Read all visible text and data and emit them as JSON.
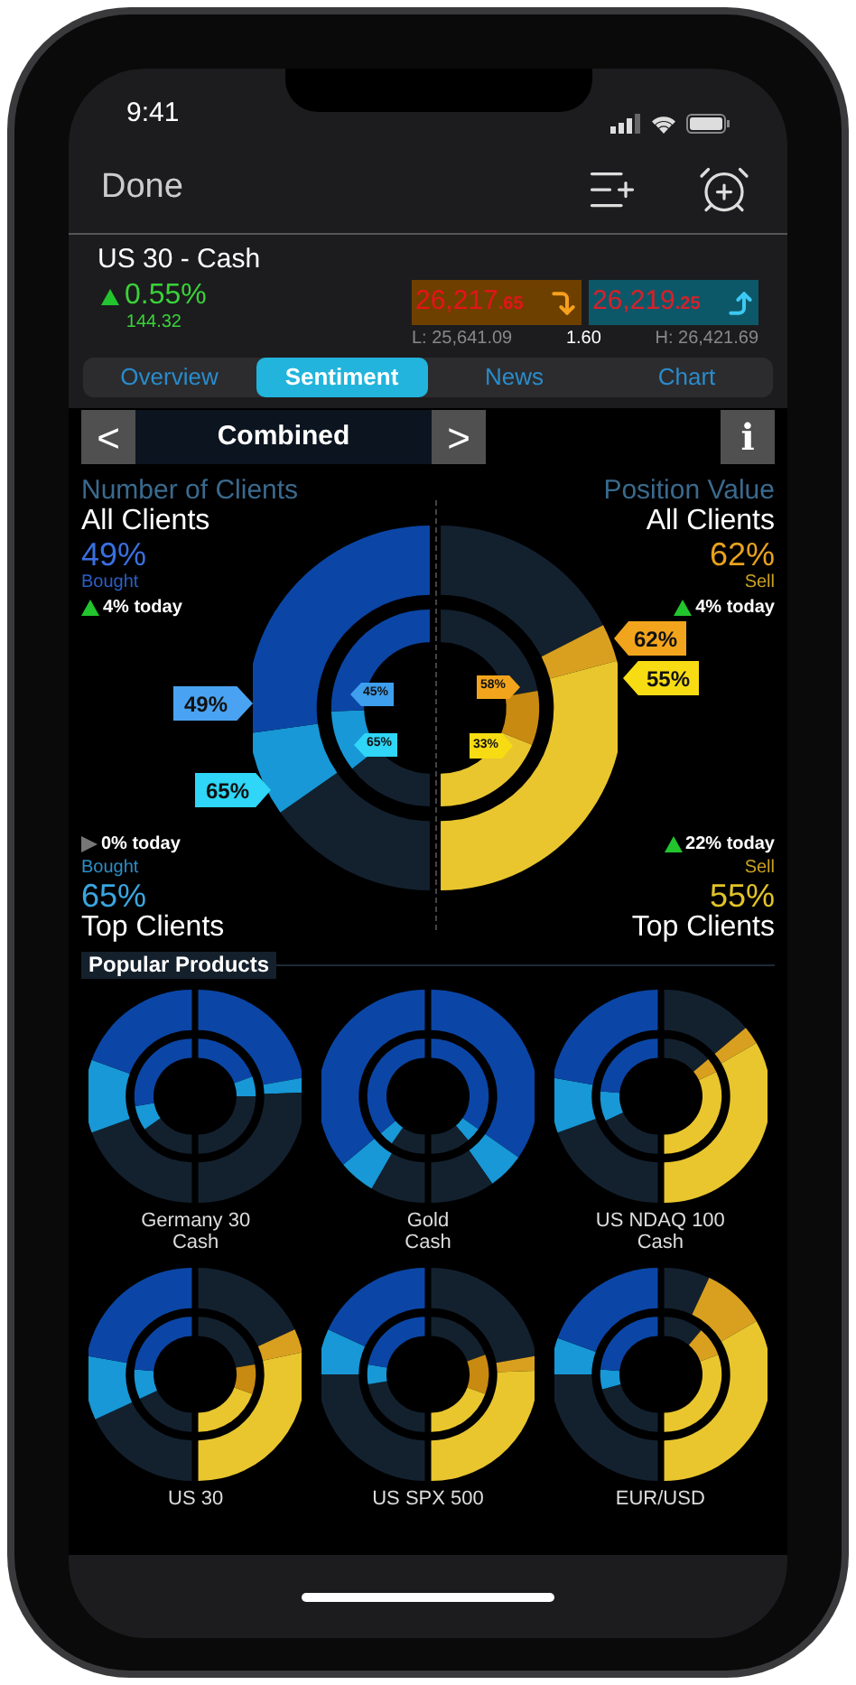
{
  "status_bar": {
    "time": "9:41"
  },
  "header": {
    "done": "Done"
  },
  "instrument": {
    "name": "US 30 - Cash",
    "change": {
      "kind": "up",
      "percent": "0.55%",
      "points": "144.32"
    },
    "sell": {
      "main": "26,217",
      "small": ".65"
    },
    "buy": {
      "main": "26,219",
      "small": ".25"
    },
    "low": "L: 25,641.09",
    "spread": "1.60",
    "high": "H: 26,421.69"
  },
  "tabs": [
    {
      "label": "Overview",
      "selected": false
    },
    {
      "label": "Sentiment",
      "selected": true
    },
    {
      "label": "News",
      "selected": false
    },
    {
      "label": "Chart",
      "selected": false
    }
  ],
  "view_selector": {
    "label": "Combined",
    "prev": "<",
    "next": ">",
    "info": "i"
  },
  "sentiment": {
    "left": {
      "title": "Number of Clients",
      "all_label": "All Clients",
      "all_value": "49%",
      "all_side": "Bought",
      "all_change": {
        "kind": "up",
        "text": "4% today"
      },
      "top_change": {
        "kind": "flat",
        "text": "0% today"
      },
      "top_side": "Bought",
      "top_value": "65%",
      "top_label": "Top Clients"
    },
    "right": {
      "title": "Position Value",
      "all_label": "All Clients",
      "all_value": "62%",
      "all_side": "Sell",
      "all_change": {
        "kind": "up",
        "text": "4% today"
      },
      "top_change": {
        "kind": "up",
        "text": "22% today"
      },
      "top_side": "Sell",
      "top_value": "55%",
      "top_label": "Top Clients"
    },
    "tags": [
      {
        "text": "62%",
        "color": "#f2a51c"
      },
      {
        "text": "49%",
        "color": "#4aa3f2"
      },
      {
        "text": "45%",
        "color": "#3d9fee"
      },
      {
        "text": "58%",
        "color": "#f2a51c"
      },
      {
        "text": "55%",
        "color": "#f7dc14"
      },
      {
        "text": "65%",
        "color": "#2fd6f7"
      },
      {
        "text": "33%",
        "color": "#f7dc14"
      },
      {
        "text": "65%",
        "color": "#2fd6f7"
      }
    ]
  },
  "popular": {
    "title": "Popular Products",
    "products": [
      {
        "name": "Germany 30\nCash"
      },
      {
        "name": "Gold\nCash"
      },
      {
        "name": "US NDAQ 100\nCash"
      },
      {
        "name": "US 30"
      },
      {
        "name": "US SPX 500"
      },
      {
        "name": "EUR/USD"
      }
    ]
  }
}
